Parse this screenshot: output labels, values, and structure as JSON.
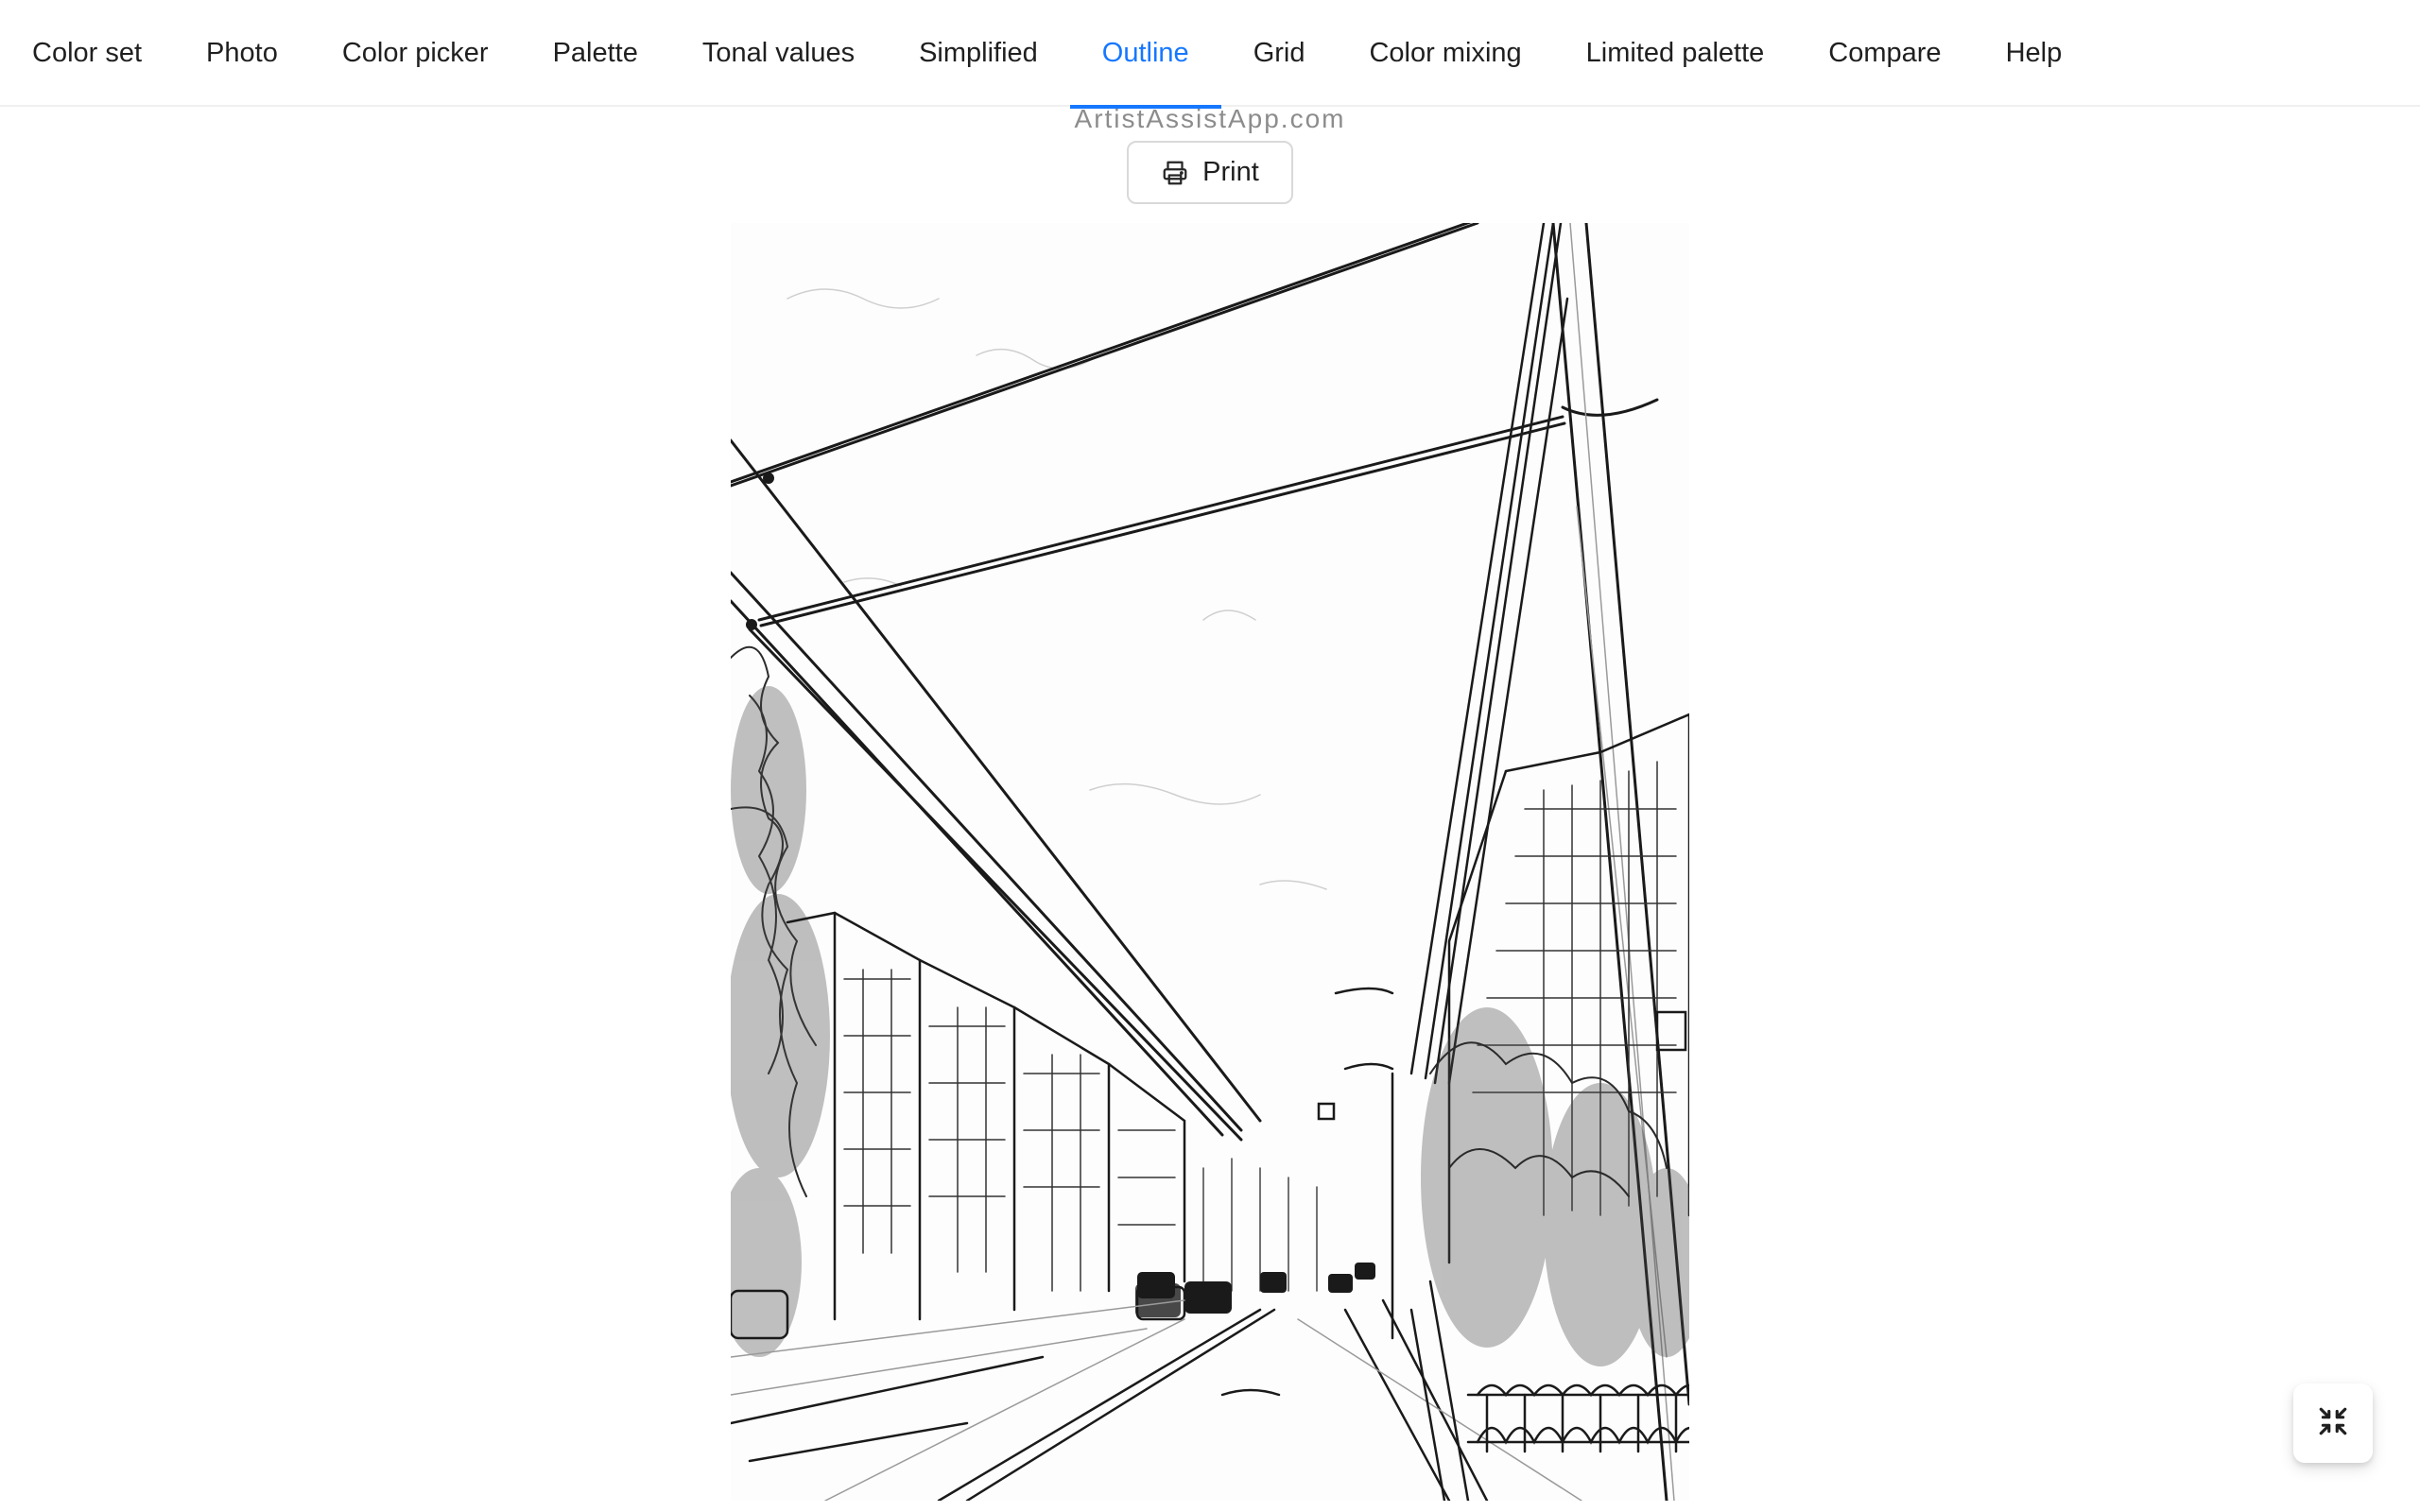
{
  "tabs": [
    {
      "label": "Color set",
      "active": false
    },
    {
      "label": "Photo",
      "active": false
    },
    {
      "label": "Color picker",
      "active": false
    },
    {
      "label": "Palette",
      "active": false
    },
    {
      "label": "Tonal values",
      "active": false
    },
    {
      "label": "Simplified",
      "active": false
    },
    {
      "label": "Outline",
      "active": true
    },
    {
      "label": "Grid",
      "active": false
    },
    {
      "label": "Color mixing",
      "active": false
    },
    {
      "label": "Limited palette",
      "active": false
    },
    {
      "label": "Compare",
      "active": false
    },
    {
      "label": "Help",
      "active": false
    }
  ],
  "content": {
    "watermark": "ArtistAssistApp.com",
    "print_label": "Print",
    "print_icon": "printer-icon",
    "fullscreen_icon": "fullscreen-exit-icon"
  },
  "colors": {
    "accent": "#1677ff",
    "text": "#1f1f1f",
    "muted": "#8c8c8c"
  }
}
